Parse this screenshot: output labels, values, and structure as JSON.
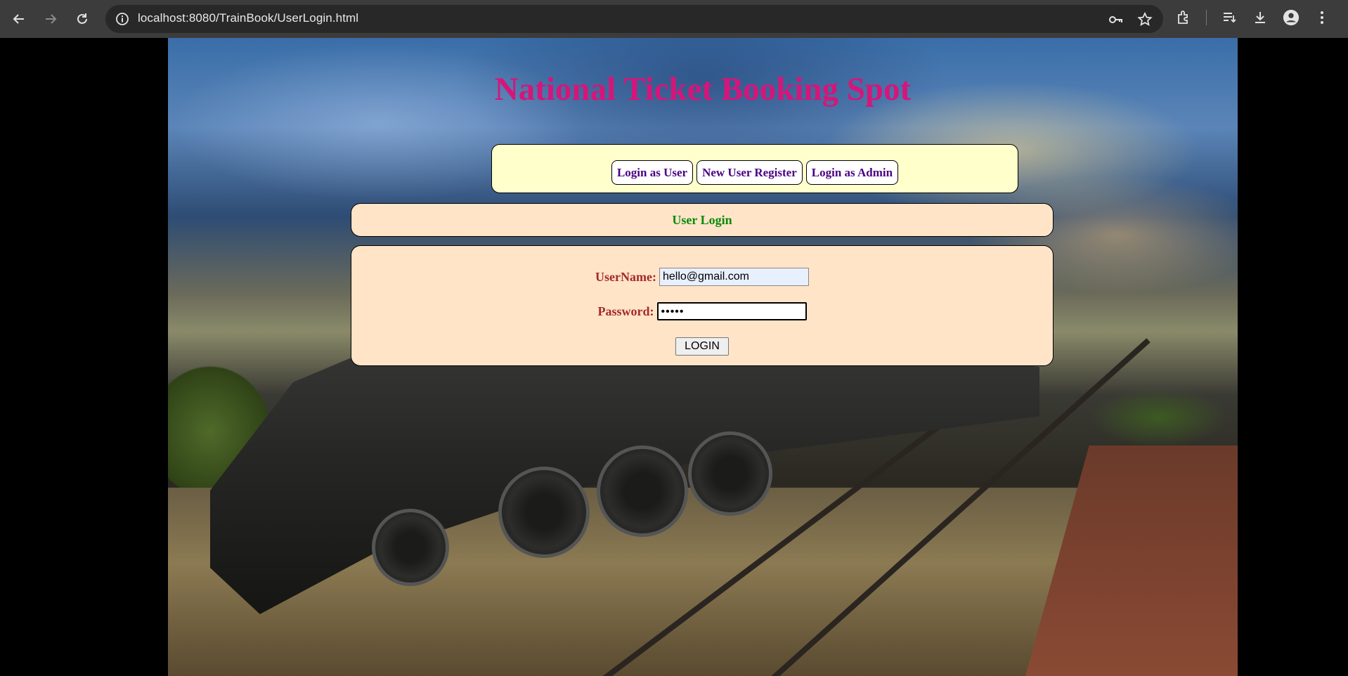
{
  "browser": {
    "url": "localhost:8080/TrainBook/UserLogin.html",
    "icons": [
      "back-icon",
      "forward-icon",
      "reload-icon",
      "site-info-icon",
      "password-key-icon",
      "bookmark-star-icon",
      "extensions-icon",
      "reading-list-icon",
      "download-icon",
      "profile-icon",
      "menu-icon"
    ]
  },
  "page": {
    "title": "National Ticket Booking Spot",
    "nav": {
      "login_user": "Login as User",
      "register": "New User Register",
      "login_admin": "Login as Admin"
    },
    "section_header": "User Login",
    "form": {
      "username_label": "UserName:",
      "username_value": "hello@gmail.com",
      "password_label": "Password:",
      "password_value": "•••••",
      "submit_label": "LOGIN"
    },
    "colors": {
      "title": "#d6157a",
      "nav_text": "#4b0082",
      "header_text": "#0a8a0a",
      "label_text": "#a52a2a",
      "nav_box_bg": "#ffffcc",
      "form_bg": "#ffe4c8"
    }
  }
}
